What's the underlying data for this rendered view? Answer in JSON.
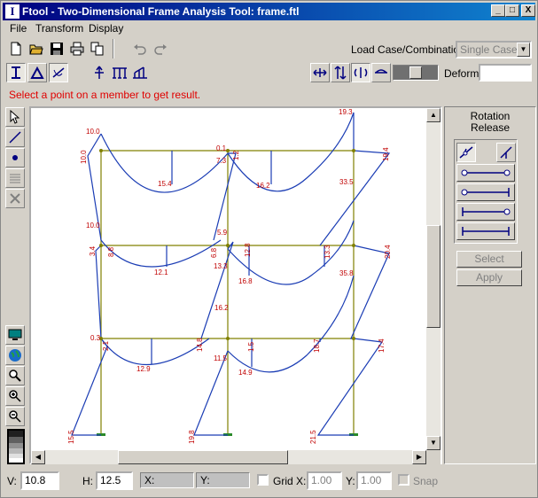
{
  "window": {
    "title": "Ftool - Two-Dimensional Frame Analysis Tool: frame.ftl",
    "app_icon": "I"
  },
  "title_buttons": {
    "minimize": "_",
    "maximize": "□",
    "close": "X"
  },
  "menu": [
    {
      "label": "File"
    },
    {
      "label": "Transform"
    },
    {
      "label": "Display"
    }
  ],
  "toolbar": {
    "load_case_label": "Load Case/Combination:",
    "load_case_value": "Single Case",
    "deform_label": "Deform:",
    "deform_value": ""
  },
  "status_message": "Select a point on a member to get result.",
  "right_panel": {
    "title_line1": "Rotation",
    "title_line2": "Release",
    "select_label": "Select",
    "apply_label": "Apply"
  },
  "bottom": {
    "v_label": "V:",
    "v_value": "10.8",
    "h_label": "H:",
    "h_value": "12.5",
    "x_label": "X:",
    "y_label": "Y:",
    "grid_label": "Grid",
    "gx_label": "X:",
    "gx_value": "1.00",
    "gy_label": "Y:",
    "gy_value": "1.00",
    "snap_label": "Snap"
  },
  "diagram_labels": [
    {
      "t": "10.0"
    },
    {
      "t": "10.0"
    },
    {
      "t": "15.4"
    },
    {
      "t": "0.1"
    },
    {
      "t": "7.3"
    },
    {
      "t": "1.2"
    },
    {
      "t": "16.2"
    },
    {
      "t": "19.3"
    },
    {
      "t": "19.4"
    },
    {
      "t": "33.5"
    },
    {
      "t": "10.0"
    },
    {
      "t": "3.4"
    },
    {
      "t": "8.8"
    },
    {
      "t": "5.9"
    },
    {
      "t": "6.8"
    },
    {
      "t": "12.1"
    },
    {
      "t": "13.3"
    },
    {
      "t": "12.8"
    },
    {
      "t": "16.8"
    },
    {
      "t": "13.3"
    },
    {
      "t": "20.4"
    },
    {
      "t": "35.8"
    },
    {
      "t": "16.2"
    },
    {
      "t": "0.3"
    },
    {
      "t": "2.1"
    },
    {
      "t": "14.8"
    },
    {
      "t": "11.5"
    },
    {
      "t": "1.5"
    },
    {
      "t": "18.7"
    },
    {
      "t": "17.4"
    },
    {
      "t": "12.9"
    },
    {
      "t": "14.9"
    },
    {
      "t": "15.5"
    },
    {
      "t": "19.8"
    },
    {
      "t": "21.5"
    }
  ],
  "colors": {
    "title_bar": "#000080",
    "frame": "#808000",
    "diagram": "#1a3cb4",
    "labels": "#c00000",
    "status": "#e00000"
  }
}
